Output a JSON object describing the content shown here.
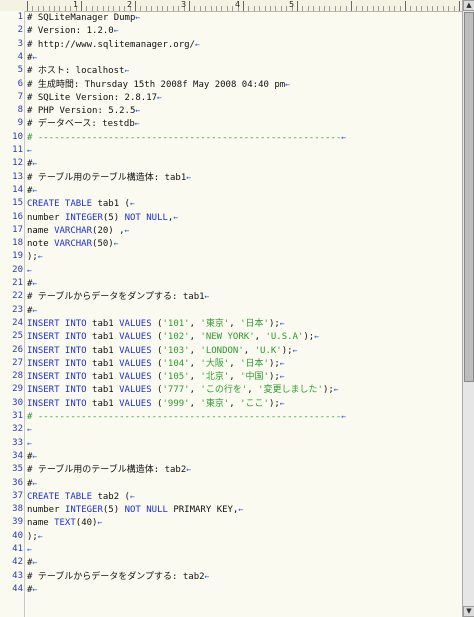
{
  "ruler": {
    "labels": [
      "1",
      "2",
      "3",
      "4",
      "5"
    ]
  },
  "lines": [
    {
      "n": "1",
      "parts": [
        {
          "t": "# SQLiteManager Dump",
          "c": "txt"
        }
      ]
    },
    {
      "n": "2",
      "parts": [
        {
          "t": "# Version: 1.2.0",
          "c": "txt"
        }
      ]
    },
    {
      "n": "3",
      "parts": [
        {
          "t": "# http://www.sqlitemanager.org/",
          "c": "txt"
        }
      ]
    },
    {
      "n": "4",
      "parts": [
        {
          "t": "#",
          "c": "txt"
        }
      ]
    },
    {
      "n": "5",
      "parts": [
        {
          "t": "# ホスト: localhost",
          "c": "txt"
        }
      ]
    },
    {
      "n": "6",
      "parts": [
        {
          "t": "# 生成時間: Thursday 15th 2008f May 2008 04:40 pm",
          "c": "txt"
        }
      ]
    },
    {
      "n": "7",
      "parts": [
        {
          "t": "# SQLite Version: 2.8.17",
          "c": "txt"
        }
      ]
    },
    {
      "n": "8",
      "parts": [
        {
          "t": "# PHP Version: 5.2.5",
          "c": "txt"
        }
      ]
    },
    {
      "n": "9",
      "parts": [
        {
          "t": "# データベース: testdb",
          "c": "txt"
        }
      ]
    },
    {
      "n": "10",
      "parts": [
        {
          "t": "# --------------------------------------------------------",
          "c": "sep"
        }
      ]
    },
    {
      "n": "11",
      "parts": []
    },
    {
      "n": "12",
      "parts": [
        {
          "t": "#",
          "c": "txt"
        }
      ]
    },
    {
      "n": "13",
      "parts": [
        {
          "t": "# テーブル用のテーブル構造体: tab1",
          "c": "txt"
        }
      ]
    },
    {
      "n": "14",
      "parts": [
        {
          "t": "#",
          "c": "txt"
        }
      ]
    },
    {
      "n": "15",
      "parts": [
        {
          "t": "CREATE TABLE",
          "c": "kw"
        },
        {
          "t": " tab1 (",
          "c": "txt"
        }
      ]
    },
    {
      "n": "16",
      "parts": [
        {
          "t": "number ",
          "c": "txt"
        },
        {
          "t": "INTEGER",
          "c": "kw"
        },
        {
          "t": "(5) ",
          "c": "txt"
        },
        {
          "t": "NOT NULL",
          "c": "kw"
        },
        {
          "t": ",",
          "c": "txt"
        }
      ]
    },
    {
      "n": "17",
      "parts": [
        {
          "t": "name ",
          "c": "txt"
        },
        {
          "t": "VARCHAR",
          "c": "kw"
        },
        {
          "t": "(20) ,",
          "c": "txt"
        }
      ]
    },
    {
      "n": "18",
      "parts": [
        {
          "t": "note ",
          "c": "txt"
        },
        {
          "t": "VARCHAR",
          "c": "kw"
        },
        {
          "t": "(50)",
          "c": "txt"
        }
      ]
    },
    {
      "n": "19",
      "parts": [
        {
          "t": ");",
          "c": "txt"
        }
      ]
    },
    {
      "n": "20",
      "parts": []
    },
    {
      "n": "21",
      "parts": [
        {
          "t": "#",
          "c": "txt"
        }
      ]
    },
    {
      "n": "22",
      "parts": [
        {
          "t": "# テーブルからデータをダンプする: tab1",
          "c": "txt"
        }
      ]
    },
    {
      "n": "23",
      "parts": [
        {
          "t": "#",
          "c": "txt"
        }
      ]
    },
    {
      "n": "24",
      "parts": [
        {
          "t": "INSERT INTO",
          "c": "kw"
        },
        {
          "t": " tab1 ",
          "c": "txt"
        },
        {
          "t": "VALUES",
          "c": "kw"
        },
        {
          "t": " (",
          "c": "txt"
        },
        {
          "t": "'101'",
          "c": "str"
        },
        {
          "t": ", ",
          "c": "txt"
        },
        {
          "t": "'東京'",
          "c": "str"
        },
        {
          "t": ", ",
          "c": "txt"
        },
        {
          "t": "'日本'",
          "c": "str"
        },
        {
          "t": ");",
          "c": "txt"
        }
      ]
    },
    {
      "n": "25",
      "parts": [
        {
          "t": "INSERT INTO",
          "c": "kw"
        },
        {
          "t": " tab1 ",
          "c": "txt"
        },
        {
          "t": "VALUES",
          "c": "kw"
        },
        {
          "t": " (",
          "c": "txt"
        },
        {
          "t": "'102'",
          "c": "str"
        },
        {
          "t": ", ",
          "c": "txt"
        },
        {
          "t": "'NEW YORK'",
          "c": "str"
        },
        {
          "t": ", ",
          "c": "txt"
        },
        {
          "t": "'U.S.A'",
          "c": "str"
        },
        {
          "t": ");",
          "c": "txt"
        }
      ]
    },
    {
      "n": "26",
      "parts": [
        {
          "t": "INSERT INTO",
          "c": "kw"
        },
        {
          "t": " tab1 ",
          "c": "txt"
        },
        {
          "t": "VALUES",
          "c": "kw"
        },
        {
          "t": " (",
          "c": "txt"
        },
        {
          "t": "'103'",
          "c": "str"
        },
        {
          "t": ", ",
          "c": "txt"
        },
        {
          "t": "'LONDON'",
          "c": "str"
        },
        {
          "t": ", ",
          "c": "txt"
        },
        {
          "t": "'U.K'",
          "c": "str"
        },
        {
          "t": ");",
          "c": "txt"
        }
      ]
    },
    {
      "n": "27",
      "parts": [
        {
          "t": "INSERT INTO",
          "c": "kw"
        },
        {
          "t": " tab1 ",
          "c": "txt"
        },
        {
          "t": "VALUES",
          "c": "kw"
        },
        {
          "t": " (",
          "c": "txt"
        },
        {
          "t": "'104'",
          "c": "str"
        },
        {
          "t": ", ",
          "c": "txt"
        },
        {
          "t": "'大阪'",
          "c": "str"
        },
        {
          "t": ", ",
          "c": "txt"
        },
        {
          "t": "'日本'",
          "c": "str"
        },
        {
          "t": ");",
          "c": "txt"
        }
      ]
    },
    {
      "n": "28",
      "parts": [
        {
          "t": "INSERT INTO",
          "c": "kw"
        },
        {
          "t": " tab1 ",
          "c": "txt"
        },
        {
          "t": "VALUES",
          "c": "kw"
        },
        {
          "t": " (",
          "c": "txt"
        },
        {
          "t": "'105'",
          "c": "str"
        },
        {
          "t": ", ",
          "c": "txt"
        },
        {
          "t": "'北京'",
          "c": "str"
        },
        {
          "t": ", ",
          "c": "txt"
        },
        {
          "t": "'中国'",
          "c": "str"
        },
        {
          "t": ");",
          "c": "txt"
        }
      ]
    },
    {
      "n": "29",
      "parts": [
        {
          "t": "INSERT INTO",
          "c": "kw"
        },
        {
          "t": " tab1 ",
          "c": "txt"
        },
        {
          "t": "VALUES",
          "c": "kw"
        },
        {
          "t": " (",
          "c": "txt"
        },
        {
          "t": "'777'",
          "c": "str"
        },
        {
          "t": ", ",
          "c": "txt"
        },
        {
          "t": "'この行を'",
          "c": "str"
        },
        {
          "t": ", ",
          "c": "txt"
        },
        {
          "t": "'変更しました'",
          "c": "str"
        },
        {
          "t": ");",
          "c": "txt"
        }
      ]
    },
    {
      "n": "30",
      "parts": [
        {
          "t": "INSERT INTO",
          "c": "kw"
        },
        {
          "t": " tab1 ",
          "c": "txt"
        },
        {
          "t": "VALUES",
          "c": "kw"
        },
        {
          "t": " (",
          "c": "txt"
        },
        {
          "t": "'999'",
          "c": "str"
        },
        {
          "t": ", ",
          "c": "txt"
        },
        {
          "t": "'東京'",
          "c": "str"
        },
        {
          "t": ", ",
          "c": "txt"
        },
        {
          "t": "'ここ'",
          "c": "str"
        },
        {
          "t": ");",
          "c": "txt"
        }
      ]
    },
    {
      "n": "31",
      "parts": [
        {
          "t": "# --------------------------------------------------------",
          "c": "sep"
        }
      ]
    },
    {
      "n": "32",
      "parts": []
    },
    {
      "n": "33",
      "parts": []
    },
    {
      "n": "34",
      "parts": [
        {
          "t": "#",
          "c": "txt"
        }
      ]
    },
    {
      "n": "35",
      "parts": [
        {
          "t": "# テーブル用のテーブル構造体: tab2",
          "c": "txt"
        }
      ]
    },
    {
      "n": "36",
      "parts": [
        {
          "t": "#",
          "c": "txt"
        }
      ]
    },
    {
      "n": "37",
      "parts": [
        {
          "t": "CREATE TABLE",
          "c": "kw"
        },
        {
          "t": " tab2 (",
          "c": "txt"
        }
      ]
    },
    {
      "n": "38",
      "parts": [
        {
          "t": "number ",
          "c": "txt"
        },
        {
          "t": "INTEGER",
          "c": "kw"
        },
        {
          "t": "(5) ",
          "c": "txt"
        },
        {
          "t": "NOT NULL",
          "c": "kw"
        },
        {
          "t": " PRIMARY KEY,",
          "c": "txt"
        }
      ]
    },
    {
      "n": "39",
      "parts": [
        {
          "t": "name ",
          "c": "txt"
        },
        {
          "t": "TEXT",
          "c": "kw"
        },
        {
          "t": "(40)",
          "c": "txt"
        }
      ]
    },
    {
      "n": "40",
      "parts": [
        {
          "t": ");",
          "c": "txt"
        }
      ]
    },
    {
      "n": "41",
      "parts": []
    },
    {
      "n": "42",
      "parts": [
        {
          "t": "#",
          "c": "txt"
        }
      ]
    },
    {
      "n": "43",
      "parts": [
        {
          "t": "# テーブルからデータをダンプする: tab2",
          "c": "txt"
        }
      ]
    },
    {
      "n": "44",
      "parts": [
        {
          "t": "#",
          "c": "txt"
        }
      ]
    }
  ],
  "scrollbar": {
    "up_icon": "arrow-up-icon",
    "down_icon": "arrow-down-icon",
    "up_glyph": "▲",
    "down_glyph": "▼"
  },
  "eol_glyph": "←",
  "colors": {
    "keyword": "#1d2fd8",
    "string": "#2d9a2d",
    "line_number": "#2a39b8",
    "background": "#fbfaf0"
  }
}
